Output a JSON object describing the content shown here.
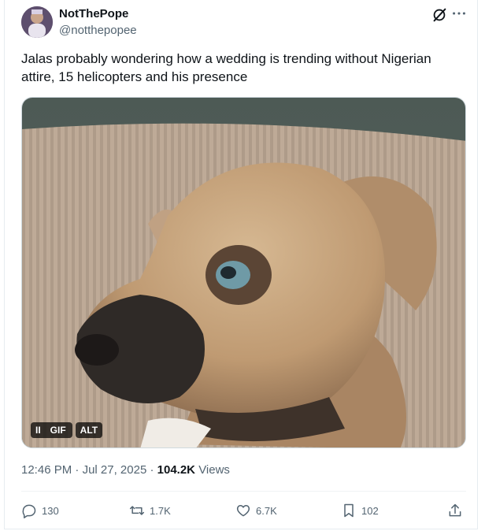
{
  "tweet": {
    "author": {
      "display_name": "NotThePope",
      "handle": "@notthepopee"
    },
    "text": "Jalas probably wondering how a wedding is trending without Nigerian attire, 15 helicopters and his presence",
    "media": {
      "badges": {
        "pause": "II",
        "gif": "GIF",
        "alt": "ALT"
      }
    },
    "meta": {
      "time": "12:46 PM",
      "separator1": "·",
      "date": "Jul 27, 2025",
      "separator2": "·",
      "views_count": "104.2K",
      "views_label": "Views"
    },
    "actions": {
      "replies": "130",
      "reposts": "1.7K",
      "likes": "6.7K",
      "bookmarks": "102"
    }
  },
  "icons": {
    "grok": "grok-icon",
    "more": "more-icon",
    "reply": "reply-icon",
    "repost": "repost-icon",
    "like": "like-icon",
    "bookmark": "bookmark-icon",
    "share": "share-icon"
  },
  "colors": {
    "text_primary": "#0f1419",
    "text_secondary": "#536471",
    "border": "#cfd9de"
  }
}
